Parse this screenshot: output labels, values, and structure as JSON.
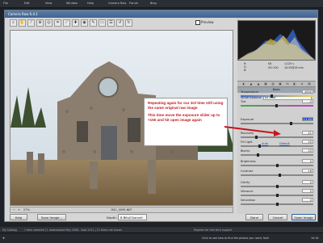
{
  "app": {
    "window_title": "Camera Raw 6.4.1"
  },
  "ps_menu": [
    "File",
    "Edit",
    "View",
    "Window",
    "Help",
    "Camera Raw",
    "Forum",
    "Blog"
  ],
  "toolbar": {
    "tools": [
      "zoom-icon",
      "hand-icon",
      "eyedropper-icon",
      "color-sampler-icon",
      "target-adjust-icon",
      "crop-icon",
      "straighten-icon",
      "spot-removal-icon",
      "redeye-icon",
      "adjustment-brush-icon",
      "graduated-filter-icon",
      "preferences-icon",
      "rotate-left-icon",
      "rotate-right-icon"
    ],
    "preview_label": "Preview"
  },
  "status": {
    "zoom": "27%",
    "filename": "DSC_0095.NEF"
  },
  "readout": {
    "r_label": "R:",
    "g_label": "G:",
    "b_label": "B:",
    "aperture": "f/8",
    "shutter": "1/125 s",
    "iso": "ISO 200",
    "focal": "18-55@18 mm"
  },
  "panel": {
    "section_title": "Basic",
    "white_balance_label": "White Balance:",
    "white_balance_value": "As Shot",
    "auto_label": "Auto",
    "default_label": "Default",
    "sliders": [
      {
        "name": "Temperature",
        "value": "4900",
        "fraction": 0.42
      },
      {
        "name": "Tint",
        "value": "-3",
        "fraction": 0.49
      },
      {
        "name": "Exposure",
        "value": "+1.50",
        "fraction": 0.69
      },
      {
        "name": "Recovery",
        "value": "21",
        "fraction": 0.21
      },
      {
        "name": "Fill Light",
        "value": "25",
        "fraction": 0.25
      },
      {
        "name": "Blacks",
        "value": "23",
        "fraction": 0.23
      },
      {
        "name": "Brightness",
        "value": "0",
        "fraction": 0.5
      },
      {
        "name": "Contrast",
        "value": "+6",
        "fraction": 0.53
      },
      {
        "name": "Clarity",
        "value": "0",
        "fraction": 0.5
      },
      {
        "name": "Vibrance",
        "value": "0",
        "fraction": 0.5
      },
      {
        "name": "Saturation",
        "value": "0",
        "fraction": 0.5
      }
    ]
  },
  "callout": {
    "line1": "Repeating again for our 3rd time still using the same original raw image",
    "line2": "This time move the exposure slider up to +150 and hit open image again"
  },
  "bottom": {
    "help_label": "Help",
    "save_label": "Save Image...",
    "depth_label": "Depth:",
    "depth_value": "8 Bits/Channel",
    "workflow_link": "sRGB IEC61966-2.1; 8 bit; 1600 by 1071 (1.7MP); 240 ppi",
    "done_label": "Done",
    "cancel_label": "Cancel",
    "open_label": "Open Image"
  },
  "info_strip": {
    "left": "My Catalog",
    "middle": "1 item selected | 1 downloaded May 2008 - Sept 2011 | 13 items not shown",
    "right": "Register for free tech support"
  },
  "taskbar": {
    "hint": "Click to see how to find the photos you need, fast!",
    "time": "10:16"
  },
  "colors": {
    "accent": "#c4161c",
    "title_bar": "#3f6390",
    "exposure_highlight": "#1f4fd0"
  }
}
